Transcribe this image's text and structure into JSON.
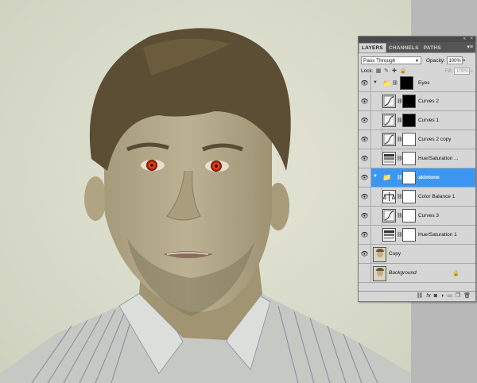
{
  "panel": {
    "tabs": [
      "LAYERS",
      "CHANNELS",
      "PATHS"
    ],
    "active_tab": "LAYERS",
    "blend_mode": "Pass Through",
    "opacity_label": "Opacity:",
    "opacity_value": "100%",
    "lock_label": "Lock:",
    "fill_label": "Fill:",
    "fill_value": "100%"
  },
  "layers": [
    {
      "name": "Eyes",
      "kind": "group",
      "visible": true
    },
    {
      "name": "Curves 2",
      "kind": "curves",
      "mask": "black",
      "visible": true
    },
    {
      "name": "Curves 1",
      "kind": "curves",
      "mask": "black",
      "visible": true
    },
    {
      "name": "Curves 2 copy",
      "kind": "curves",
      "mask": "white",
      "visible": true
    },
    {
      "name": "Hue/Saturation ...",
      "kind": "hue",
      "mask": "white",
      "visible": true
    },
    {
      "name": "skintone",
      "kind": "group",
      "selected": true,
      "visible": true
    },
    {
      "name": "Color Balance 1",
      "kind": "balance",
      "mask": "white",
      "visible": true
    },
    {
      "name": "Curves 3",
      "kind": "curves",
      "mask": "white",
      "visible": true
    },
    {
      "name": "Hue/Saturation 1",
      "kind": "hue",
      "mask": "white",
      "visible": true
    },
    {
      "name": "Copy",
      "kind": "photo",
      "visible": true
    },
    {
      "name": "Background",
      "kind": "photo",
      "visible": false,
      "locked": true
    }
  ],
  "colors": {
    "selection": "#3d97f2",
    "panel": "#d6d6d6",
    "eye_glow": "#ff3a1a"
  }
}
